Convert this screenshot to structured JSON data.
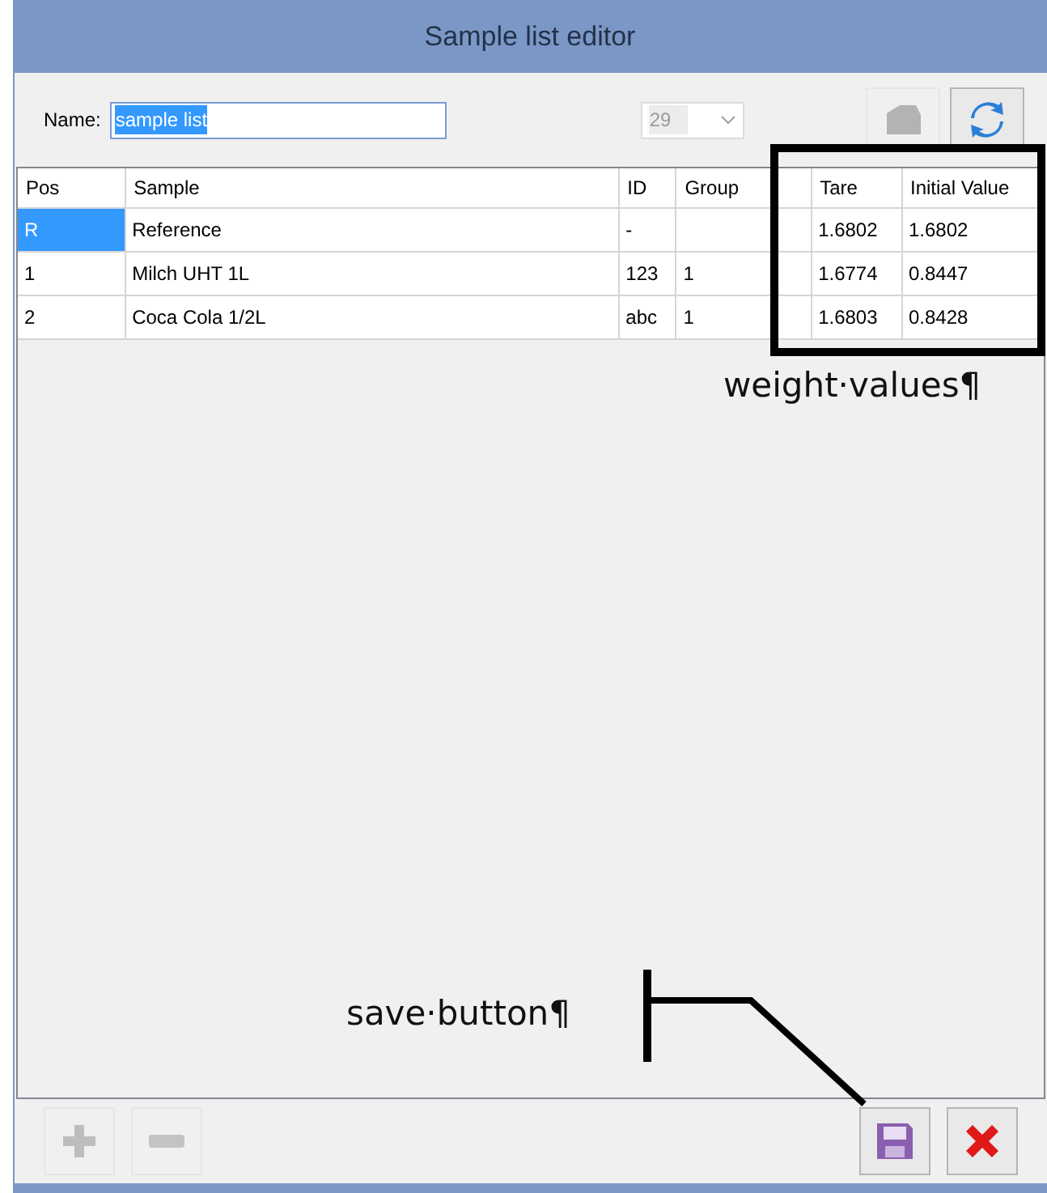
{
  "window": {
    "title": "Sample list editor"
  },
  "name_field": {
    "label": "Name:",
    "value": "sample list",
    "text_selected": true
  },
  "count_dropdown": {
    "value": "29",
    "disabled": true
  },
  "toolbar": [
    {
      "kind": "weigh",
      "disabled": true
    },
    {
      "kind": "refresh",
      "disabled": false
    }
  ],
  "table": {
    "columns": [
      "Pos",
      "Sample",
      "ID",
      "Group",
      "",
      "Tare",
      "Initial Value"
    ],
    "rows": [
      {
        "selected": true,
        "cells": [
          "R",
          "Reference",
          "-",
          "",
          "",
          "1.6802",
          "1.6802"
        ]
      },
      {
        "selected": false,
        "cells": [
          "1",
          "Milch UHT 1L",
          "123",
          "1",
          "",
          "1.6774",
          "0.8447"
        ]
      },
      {
        "selected": false,
        "cells": [
          "2",
          "Coca Cola 1/2L",
          "abc",
          "1",
          "",
          "1.6803",
          "0.8428"
        ]
      }
    ]
  },
  "bottom_buttons": [
    {
      "kind": "add",
      "disabled": true
    },
    {
      "kind": "remove",
      "disabled": true
    },
    {
      "kind": "save",
      "disabled": false
    },
    {
      "kind": "cancel",
      "disabled": false
    }
  ],
  "annotations": [
    {
      "kind": "box",
      "label": "weight·values¶"
    },
    {
      "kind": "leader",
      "label": "save·button¶"
    }
  ]
}
